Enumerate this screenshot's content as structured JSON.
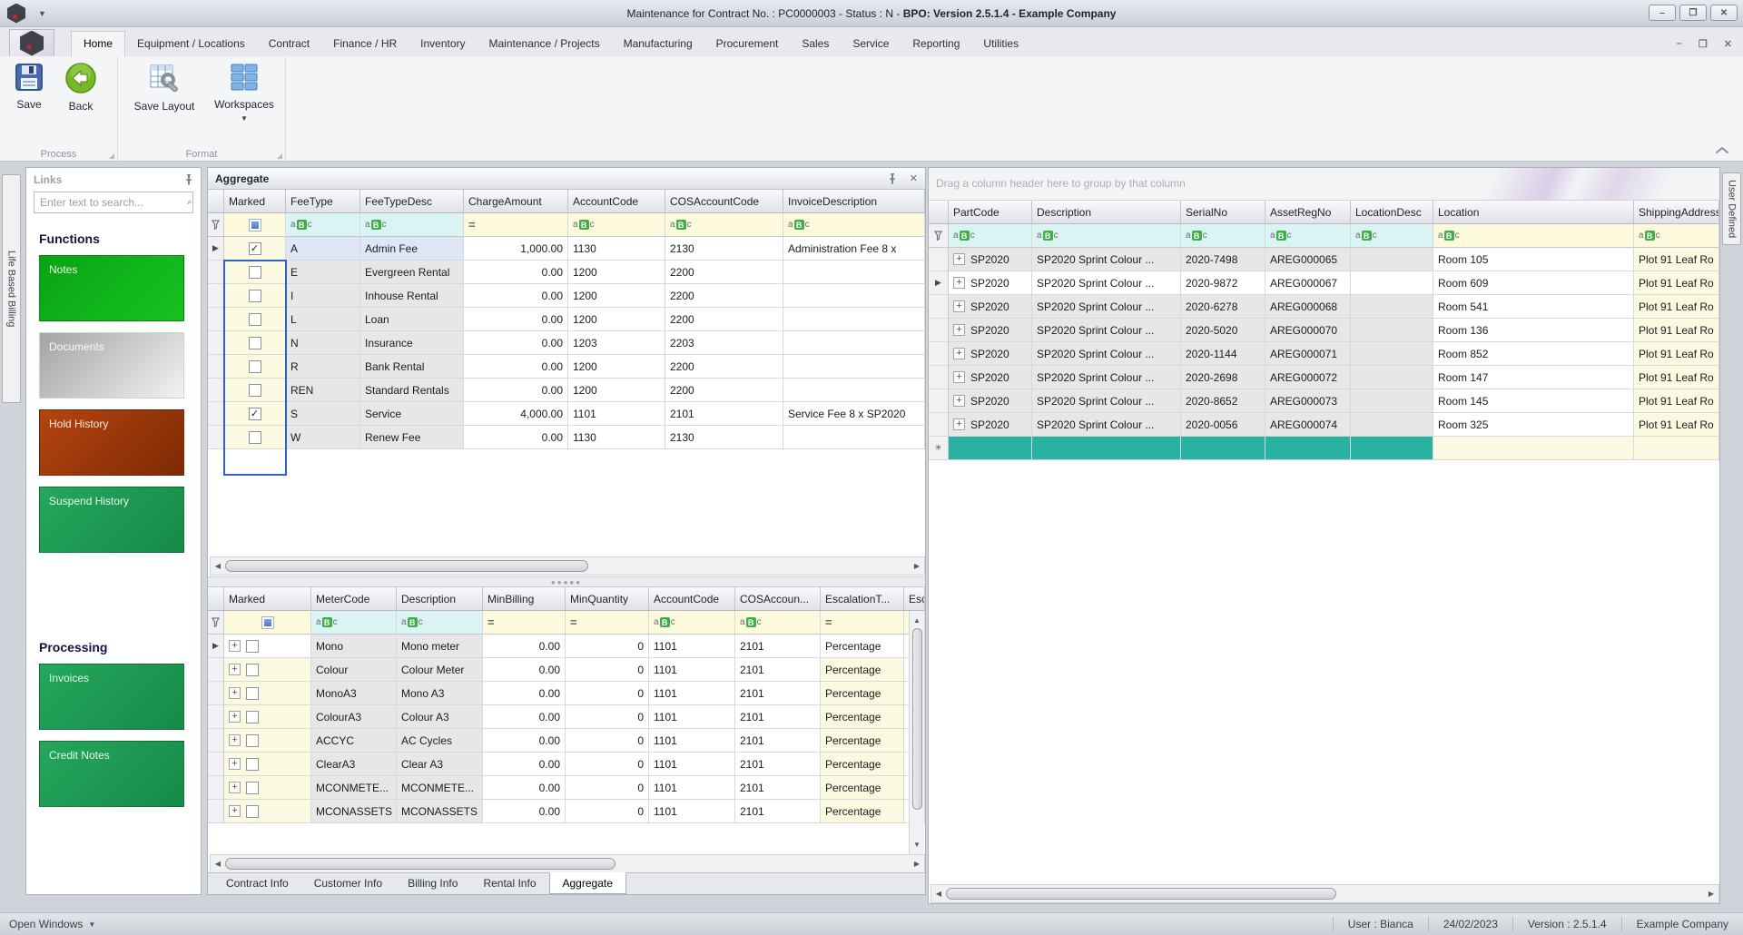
{
  "window": {
    "title_normal": "Maintenance for Contract No. : PC0000003 - Status : N - ",
    "title_bold": "BPO: Version 2.5.1.4 - Example Company",
    "controls": {
      "minimize": "–",
      "restore": "❐",
      "close": "✕"
    }
  },
  "ribbon": {
    "tabs": [
      "Home",
      "Equipment / Locations",
      "Contract",
      "Finance / HR",
      "Inventory",
      "Maintenance / Projects",
      "Manufacturing",
      "Procurement",
      "Sales",
      "Service",
      "Reporting",
      "Utilities"
    ],
    "active_tab": "Home",
    "buttons": {
      "save": "Save",
      "back": "Back",
      "save_layout": "Save Layout",
      "workspaces": "Workspaces"
    },
    "groups": [
      "Process",
      "Format"
    ]
  },
  "side_tabs": {
    "left": "Life Based Billing",
    "right": "User Defined"
  },
  "links": {
    "caption": "Links",
    "search_placeholder": "Enter text to search...",
    "sections": [
      {
        "heading": "Functions",
        "buttons": [
          {
            "label": "Notes",
            "style": "green-bright"
          },
          {
            "label": "Documents",
            "style": "silver"
          },
          {
            "label": "Hold History",
            "style": "rust"
          },
          {
            "label": "Suspend History",
            "style": "green"
          }
        ]
      },
      {
        "heading": "Processing",
        "buttons": [
          {
            "label": "Invoices",
            "style": "green"
          },
          {
            "label": "Credit Notes",
            "style": "green"
          }
        ]
      }
    ]
  },
  "aggregate": {
    "caption": "Aggregate",
    "fee_grid": {
      "columns": [
        "Marked",
        "FeeType",
        "FeeTypeDesc",
        "ChargeAmount",
        "AccountCode",
        "COSAccountCode",
        "InvoiceDescription"
      ],
      "rows": [
        {
          "marked": true,
          "feetype": "A",
          "desc": "Admin Fee",
          "amount": "1,000.00",
          "account": "1130",
          "cos": "2130",
          "invoice": "Administration Fee 8 x"
        },
        {
          "marked": false,
          "feetype": "E",
          "desc": "Evergreen Rental",
          "amount": "0.00",
          "account": "1200",
          "cos": "2200",
          "invoice": ""
        },
        {
          "marked": false,
          "feetype": "I",
          "desc": "Inhouse Rental",
          "amount": "0.00",
          "account": "1200",
          "cos": "2200",
          "invoice": ""
        },
        {
          "marked": false,
          "feetype": "L",
          "desc": "Loan",
          "amount": "0.00",
          "account": "1200",
          "cos": "2200",
          "invoice": ""
        },
        {
          "marked": false,
          "feetype": "N",
          "desc": "Insurance",
          "amount": "0.00",
          "account": "1203",
          "cos": "2203",
          "invoice": ""
        },
        {
          "marked": false,
          "feetype": "R",
          "desc": "Bank Rental",
          "amount": "0.00",
          "account": "1200",
          "cos": "2200",
          "invoice": ""
        },
        {
          "marked": false,
          "feetype": "REN",
          "desc": "Standard Rentals",
          "amount": "0.00",
          "account": "1200",
          "cos": "2200",
          "invoice": ""
        },
        {
          "marked": true,
          "feetype": "S",
          "desc": "Service",
          "amount": "4,000.00",
          "account": "1101",
          "cos": "2101",
          "invoice": "Service Fee 8 x SP2020"
        },
        {
          "marked": false,
          "feetype": "W",
          "desc": "Renew Fee",
          "amount": "0.00",
          "account": "1130",
          "cos": "2130",
          "invoice": ""
        }
      ]
    },
    "meter_grid": {
      "columns": [
        "Marked",
        "MeterCode",
        "Description",
        "MinBilling",
        "MinQuantity",
        "AccountCode",
        "COSAccoun...",
        "EscalationT...",
        "Esc"
      ],
      "rows": [
        {
          "code": "Mono",
          "desc": "Mono meter",
          "minbill": "0.00",
          "minqty": "0",
          "account": "1101",
          "cos": "2101",
          "esc": "Percentage"
        },
        {
          "code": "Colour",
          "desc": "Colour Meter",
          "minbill": "0.00",
          "minqty": "0",
          "account": "1101",
          "cos": "2101",
          "esc": "Percentage"
        },
        {
          "code": "MonoA3",
          "desc": "Mono A3",
          "minbill": "0.00",
          "minqty": "0",
          "account": "1101",
          "cos": "2101",
          "esc": "Percentage"
        },
        {
          "code": "ColourA3",
          "desc": "Colour A3",
          "minbill": "0.00",
          "minqty": "0",
          "account": "1101",
          "cos": "2101",
          "esc": "Percentage"
        },
        {
          "code": "ACCYC",
          "desc": "AC Cycles",
          "minbill": "0.00",
          "minqty": "0",
          "account": "1101",
          "cos": "2101",
          "esc": "Percentage"
        },
        {
          "code": "ClearA3",
          "desc": "Clear A3",
          "minbill": "0.00",
          "minqty": "0",
          "account": "1101",
          "cos": "2101",
          "esc": "Percentage"
        },
        {
          "code": "MCONMETE...",
          "desc": "MCONMETE...",
          "minbill": "0.00",
          "minqty": "0",
          "account": "1101",
          "cos": "2101",
          "esc": "Percentage"
        },
        {
          "code": "MCONASSETS",
          "desc": "MCONASSETS",
          "minbill": "0.00",
          "minqty": "0",
          "account": "1101",
          "cos": "2101",
          "esc": "Percentage"
        }
      ]
    },
    "doc_tabs": [
      "Contract Info",
      "Customer Info",
      "Billing Info",
      "Rental Info",
      "Aggregate"
    ],
    "active_doc_tab": "Aggregate"
  },
  "equipment": {
    "group_hint": "Drag a column header here to group by that column",
    "columns": [
      "PartCode",
      "Description",
      "SerialNo",
      "AssetRegNo",
      "LocationDesc",
      "Location",
      "ShippingAddress"
    ],
    "rows": [
      {
        "part": "SP2020",
        "desc": "SP2020 Sprint Colour ...",
        "serial": "2020-7498",
        "asset": "AREG000065",
        "locdesc": "",
        "location": "Room 105",
        "shipping": "Plot 91 Leaf Ro"
      },
      {
        "part": "SP2020",
        "desc": "SP2020 Sprint Colour ...",
        "serial": "2020-9872",
        "asset": "AREG000067",
        "locdesc": "",
        "location": "Room 609",
        "shipping": "Plot 91 Leaf Ro"
      },
      {
        "part": "SP2020",
        "desc": "SP2020 Sprint Colour ...",
        "serial": "2020-6278",
        "asset": "AREG000068",
        "locdesc": "",
        "location": "Room 541",
        "shipping": "Plot 91 Leaf Ro"
      },
      {
        "part": "SP2020",
        "desc": "SP2020 Sprint Colour ...",
        "serial": "2020-5020",
        "asset": "AREG000070",
        "locdesc": "",
        "location": "Room 136",
        "shipping": "Plot 91 Leaf Ro"
      },
      {
        "part": "SP2020",
        "desc": "SP2020 Sprint Colour ...",
        "serial": "2020-1144",
        "asset": "AREG000071",
        "locdesc": "",
        "location": "Room 852",
        "shipping": "Plot 91 Leaf Ro"
      },
      {
        "part": "SP2020",
        "desc": "SP2020 Sprint Colour ...",
        "serial": "2020-2698",
        "asset": "AREG000072",
        "locdesc": "",
        "location": "Room 147",
        "shipping": "Plot 91 Leaf Ro"
      },
      {
        "part": "SP2020",
        "desc": "SP2020 Sprint Colour ...",
        "serial": "2020-8652",
        "asset": "AREG000073",
        "locdesc": "",
        "location": "Room 145",
        "shipping": "Plot 91 Leaf Ro"
      },
      {
        "part": "SP2020",
        "desc": "SP2020 Sprint Colour ...",
        "serial": "2020-0056",
        "asset": "AREG000074",
        "locdesc": "",
        "location": "Room 325",
        "shipping": "Plot 91 Leaf Ro"
      }
    ]
  },
  "statusbar": {
    "open_windows": "Open Windows",
    "user": "User : Bianca",
    "date": "24/02/2023",
    "version": "Version : 2.5.1.4",
    "company": "Example Company"
  },
  "colors": {
    "teal_new_row": "#29b2a2",
    "filter_yellow": "#fcf9dd",
    "filter_cyan": "#d9f4f3",
    "focus_blue": "#3261c1",
    "green_button": "#1d9e52",
    "bright_green_button": "#0db01e",
    "rust_button": "#a1380b",
    "checkbox_green_icon": "#3fae49"
  }
}
